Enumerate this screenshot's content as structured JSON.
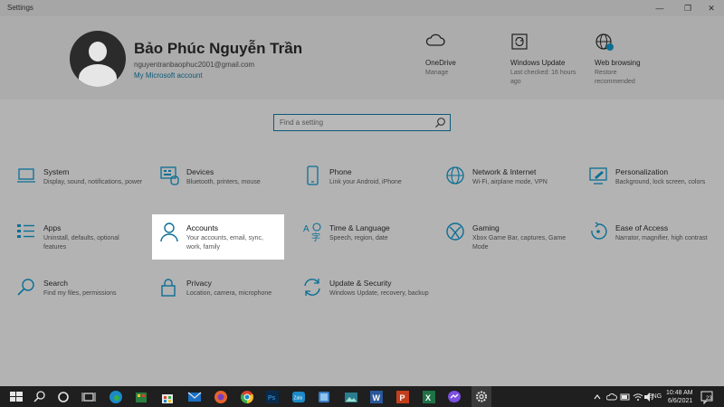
{
  "window": {
    "title": "Settings",
    "minimize": "—",
    "maximize": "❐",
    "close": "✕"
  },
  "profile": {
    "name": "Bảo Phúc Nguyễn Trần",
    "email": "nguyentranbaophuc2001@gmail.com",
    "account_link": "My Microsoft account"
  },
  "quick_items": [
    {
      "label": "OneDrive",
      "desc": "Manage",
      "icon": "cloud-icon"
    },
    {
      "label": "Windows Update",
      "desc": "Last checked: 16 hours ago",
      "icon": "refresh-icon"
    },
    {
      "label": "Web browsing",
      "desc": "Restore recommended",
      "icon": "globe-icon"
    }
  ],
  "search": {
    "placeholder": "Find a setting"
  },
  "tiles": [
    {
      "name": "System",
      "desc": "Display, sound, notifications, power",
      "icon": "laptop-icon"
    },
    {
      "name": "Devices",
      "desc": "Bluetooth, printers, mouse",
      "icon": "keyboard-icon"
    },
    {
      "name": "Phone",
      "desc": "Link your Android, iPhone",
      "icon": "phone-icon"
    },
    {
      "name": "Network & Internet",
      "desc": "Wi-Fi, airplane mode, VPN",
      "icon": "globe-icon"
    },
    {
      "name": "Personalization",
      "desc": "Background, lock screen, colors",
      "icon": "paint-icon"
    },
    {
      "name": "Apps",
      "desc": "Uninstall, defaults, optional features",
      "icon": "apps-list-icon"
    },
    {
      "name": "Accounts",
      "desc": "Your accounts, email, sync, work, family",
      "icon": "person-icon"
    },
    {
      "name": "Time & Language",
      "desc": "Speech, region, date",
      "icon": "time-language-icon"
    },
    {
      "name": "Gaming",
      "desc": "Xbox Game Bar, captures, Game Mode",
      "icon": "xbox-icon"
    },
    {
      "name": "Ease of Access",
      "desc": "Narrator, magnifier, high contrast",
      "icon": "ease-of-access-icon"
    },
    {
      "name": "Search",
      "desc": "Find my files, permissions",
      "icon": "search-icon"
    },
    {
      "name": "Privacy",
      "desc": "Location, camera, microphone",
      "icon": "lock-icon"
    },
    {
      "name": "Update & Security",
      "desc": "Windows Update, recovery, backup",
      "icon": "update-icon"
    }
  ],
  "taskbar": {
    "time": "10:48 AM",
    "date": "6/6/2021",
    "lang": "ENG",
    "notifications": "23"
  },
  "colors": {
    "accent": "#0b5a7a",
    "icon": "#0c6f95",
    "taskbar": "#1f1f1f"
  }
}
